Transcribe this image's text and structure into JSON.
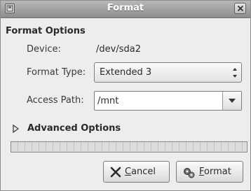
{
  "window": {
    "title": "Format"
  },
  "form": {
    "section_title": "Format Options",
    "device_label": "Device:",
    "device_value": "/dev/sda2",
    "format_type_label": "Format Type:",
    "format_type_value": "Extended 3",
    "access_path_label": "Access Path:",
    "access_path_value": "/mnt"
  },
  "advanced": {
    "label": "Advanced Options",
    "expanded": false
  },
  "progress": {
    "fraction": 0
  },
  "buttons": {
    "cancel_first": "C",
    "cancel_rest": "ancel",
    "format_first": "F",
    "format_rest": "ormat"
  },
  "icons": {
    "window_icon": "disk-icon",
    "close": "close-icon",
    "cancel": "cancel-icon",
    "format": "format-gears-icon"
  }
}
